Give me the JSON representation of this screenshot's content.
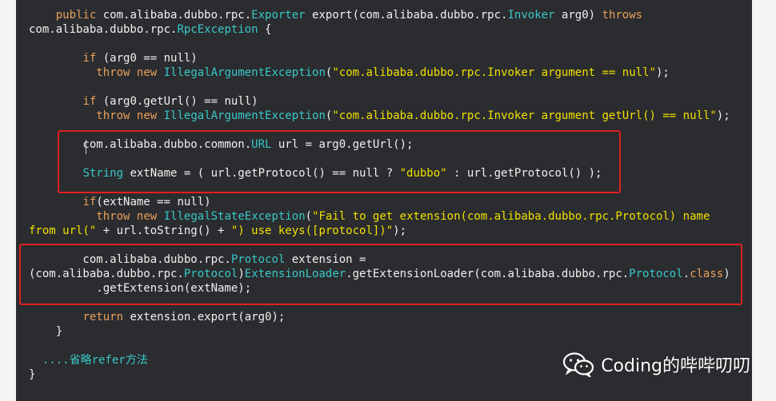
{
  "code": {
    "lines": [
      [
        [
          "    ",
          "id"
        ],
        [
          "public",
          "kw"
        ],
        [
          " com.alibaba.dubbo.rpc.",
          "id"
        ],
        [
          "Exporter",
          "type"
        ],
        [
          " export(com.alibaba.dubbo.rpc.",
          "id"
        ],
        [
          "Invoker",
          "type"
        ],
        [
          " arg0) ",
          "id"
        ],
        [
          "throws",
          "kw"
        ]
      ],
      [
        [
          "com.alibaba.dubbo.rpc.",
          "id"
        ],
        [
          "RpcException",
          "type"
        ],
        [
          " {",
          "id"
        ]
      ],
      [
        [
          "",
          "id"
        ]
      ],
      [
        [
          "        ",
          "id"
        ],
        [
          "if",
          "kw"
        ],
        [
          " (arg0 == null)",
          "id"
        ]
      ],
      [
        [
          "          ",
          "id"
        ],
        [
          "throw",
          "kw"
        ],
        [
          " ",
          "id"
        ],
        [
          "new",
          "kw"
        ],
        [
          " ",
          "id"
        ],
        [
          "IllegalArgumentException",
          "type"
        ],
        [
          "(",
          "id"
        ],
        [
          "\"com.alibaba.dubbo.rpc.Invoker argument == null\"",
          "str"
        ],
        [
          ");",
          "id"
        ]
      ],
      [
        [
          "",
          "id"
        ]
      ],
      [
        [
          "        ",
          "id"
        ],
        [
          "if",
          "kw"
        ],
        [
          " (arg0.getUrl() == null)",
          "id"
        ]
      ],
      [
        [
          "          ",
          "id"
        ],
        [
          "throw",
          "kw"
        ],
        [
          " ",
          "id"
        ],
        [
          "new",
          "kw"
        ],
        [
          " ",
          "id"
        ],
        [
          "IllegalArgumentException",
          "type"
        ],
        [
          "(",
          "id"
        ],
        [
          "\"com.alibaba.dubbo.rpc.Invoker argument getUrl() == null\"",
          "str"
        ],
        [
          ");",
          "id"
        ]
      ],
      [
        [
          "",
          "id"
        ]
      ],
      [
        [
          "        com.alibaba.dubbo.common.",
          "id"
        ],
        [
          "URL",
          "type"
        ],
        [
          " url = arg0.getUrl();",
          "id"
        ]
      ],
      [
        [
          "",
          "id"
        ]
      ],
      [
        [
          "        ",
          "id"
        ],
        [
          "String",
          "type"
        ],
        [
          " extName = ( url.getProtocol() == null ? ",
          "id"
        ],
        [
          "\"dubbo\"",
          "str"
        ],
        [
          " : url.getProtocol() );",
          "id"
        ]
      ],
      [
        [
          "",
          "id"
        ]
      ],
      [
        [
          "        ",
          "id"
        ],
        [
          "if",
          "kw"
        ],
        [
          "(extName == null)",
          "id"
        ]
      ],
      [
        [
          "          ",
          "id"
        ],
        [
          "throw",
          "kw"
        ],
        [
          " ",
          "id"
        ],
        [
          "new",
          "kw"
        ],
        [
          " ",
          "id"
        ],
        [
          "IllegalStateException",
          "type"
        ],
        [
          "(",
          "id"
        ],
        [
          "\"Fail to get extension(com.alibaba.dubbo.rpc.Protocol) name",
          "str"
        ]
      ],
      [
        [
          "from url(\"",
          "str"
        ],
        [
          " + url.toString() + ",
          "id"
        ],
        [
          "\") use keys([protocol])\"",
          "str"
        ],
        [
          ");",
          "id"
        ]
      ],
      [
        [
          "",
          "id"
        ]
      ],
      [
        [
          "        com.alibaba.dubbo.rpc.",
          "id"
        ],
        [
          "Protocol",
          "type"
        ],
        [
          " extension =",
          "id"
        ]
      ],
      [
        [
          "(com.alibaba.dubbo.rpc.",
          "id"
        ],
        [
          "Protocol",
          "type"
        ],
        [
          ")",
          "id"
        ],
        [
          "ExtensionLoader",
          "type"
        ],
        [
          ".getExtensionLoader(com.alibaba.dubbo.rpc.",
          "id"
        ],
        [
          "Protocol",
          "type"
        ],
        [
          ".",
          "id"
        ],
        [
          "class",
          "kw"
        ],
        [
          ")",
          "id"
        ]
      ],
      [
        [
          "          .getExtension(extName);",
          "id"
        ]
      ],
      [
        [
          "",
          "id"
        ]
      ],
      [
        [
          "        ",
          "id"
        ],
        [
          "return",
          "kw"
        ],
        [
          " extension.export(arg0);",
          "id"
        ]
      ],
      [
        [
          "    }",
          "id"
        ]
      ],
      [
        [
          "",
          "id"
        ]
      ],
      [
        [
          "  ....省略refer方法",
          "cm"
        ]
      ],
      [
        [
          "}",
          "id"
        ]
      ]
    ]
  },
  "watermark": {
    "text": "Coding的哔哔叨叨",
    "icon": "wechat-icon"
  },
  "colors": {
    "background": "#2b2c2f",
    "keyword": "#e8a05a",
    "type": "#38c8c8",
    "string": "#f0e000",
    "identifier": "#f0f0f0",
    "highlight_box": "#e02020"
  }
}
